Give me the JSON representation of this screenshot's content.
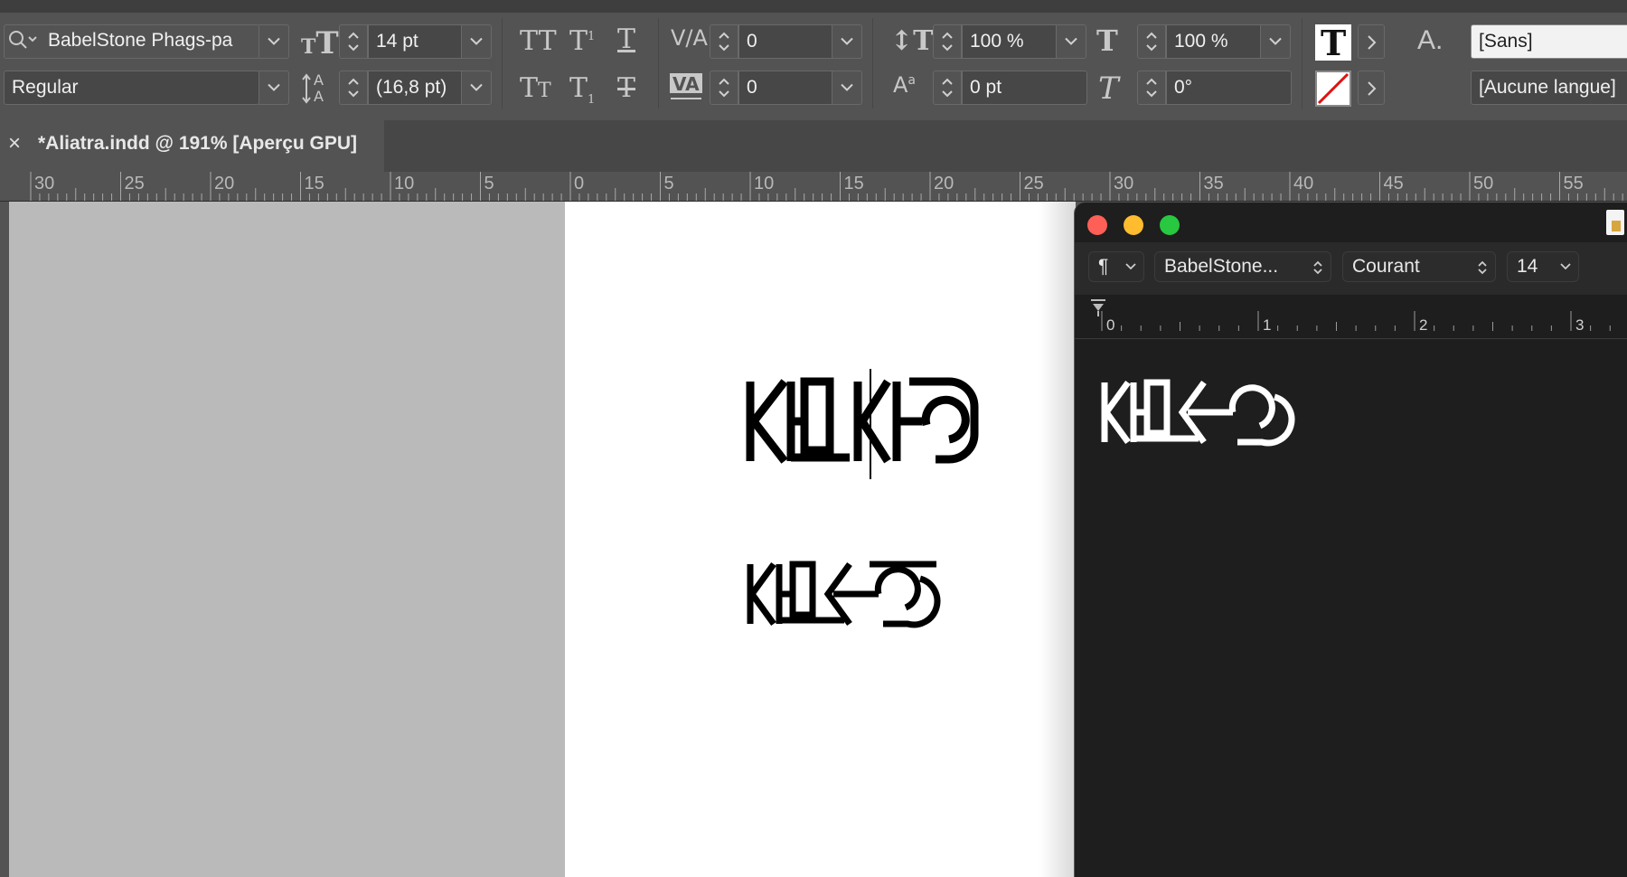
{
  "control_bar": {
    "font_family": "BabelStone Phags-pa",
    "font_style": "Regular",
    "font_size": "14 pt",
    "leading": "(16,8 pt)",
    "kerning": "0",
    "tracking": "0",
    "vertical_scale": "100 %",
    "horizontal_scale": "100 %",
    "baseline_shift": "0 pt",
    "skew": "0°",
    "char_style": "[Sans]",
    "language": "[Aucune langue]"
  },
  "document_tab": {
    "close_glyph": "×",
    "title": "*Aliatra.indd @ 191% [Aperçu GPU]"
  },
  "ruler": {
    "labels": [
      "30",
      "25",
      "20",
      "15",
      "10",
      "5",
      "0",
      "5",
      "10",
      "15",
      "20",
      "25",
      "30",
      "35",
      "40",
      "45",
      "50",
      "55"
    ]
  },
  "text_editor": {
    "paragraph_glyph": "¶",
    "font": "BabelStone...",
    "style": "Courant",
    "size": "14",
    "ruler_labels": [
      "0",
      "1",
      "2",
      "3"
    ]
  },
  "colors": {
    "traffic_red": "#fe5f57",
    "traffic_yellow": "#febc2e",
    "traffic_green": "#28c840"
  }
}
